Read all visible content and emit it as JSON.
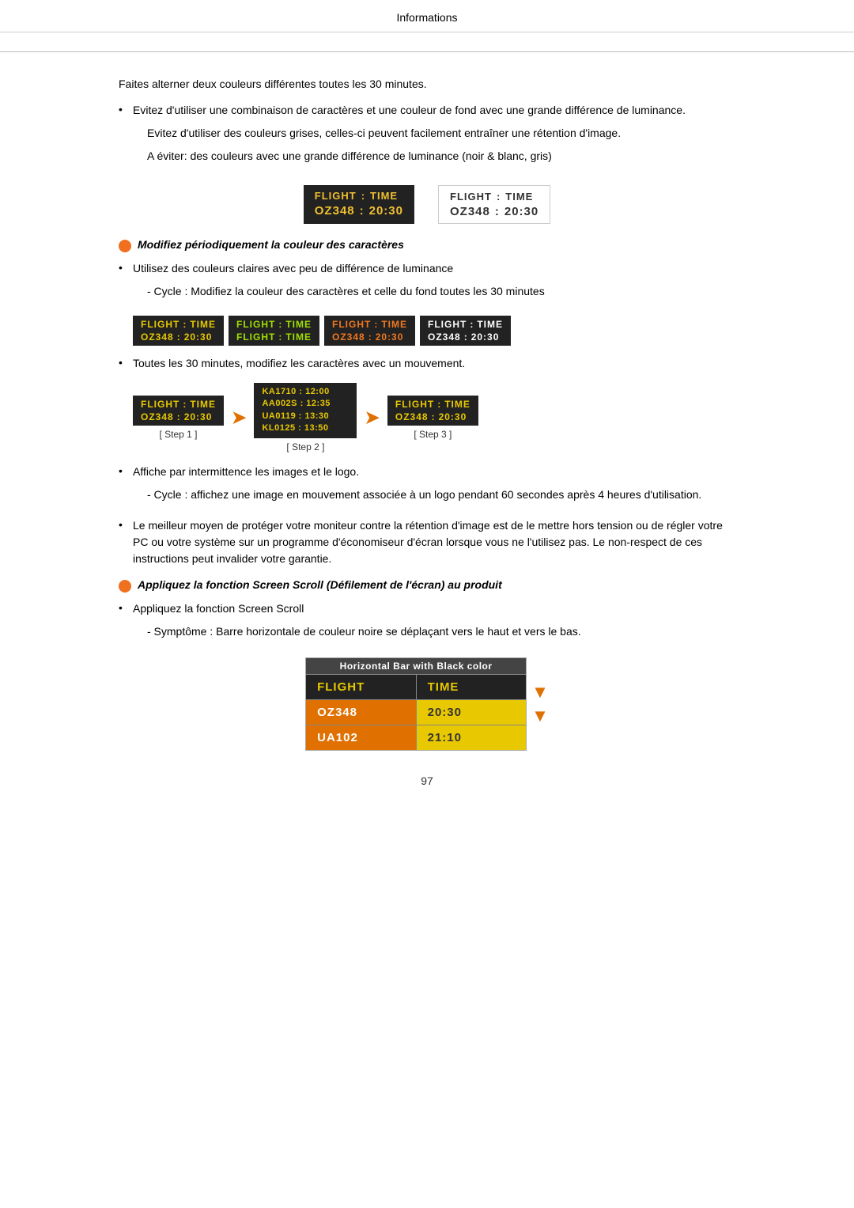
{
  "page": {
    "header": "Informations",
    "page_number": "97"
  },
  "intro": {
    "line1": "Faites alterner deux couleurs différentes toutes les 30 minutes."
  },
  "bullets": {
    "b1_text": "Evitez d'utiliser une combinaison de caractères et une couleur de fond avec une grande différence de luminance.",
    "b1_sub1": "Evitez d'utiliser des couleurs grises, celles-ci peuvent facilement entraîner une rétention d'image.",
    "b1_sub2": "A éviter: des couleurs avec une grande différence de luminance (noir & blanc, gris)"
  },
  "flight_boards": {
    "dark": {
      "title1": "FLIGHT",
      "sep1": ":",
      "title2": "TIME",
      "data1": "OZ348",
      "sep2": ":",
      "data2": "20:30"
    },
    "light": {
      "title1": "FLIGHT",
      "sep1": ":",
      "title2": "TIME",
      "data1": "OZ348",
      "sep2": ":",
      "data2": "20:30"
    }
  },
  "orange_bullet1": {
    "text": "Modifiez périodiquement la couleur des caractères"
  },
  "bullet2_text": "Utilisez des couleurs claires avec peu de différence de luminance",
  "bullet2_sub": "- Cycle : Modifiez la couleur des caractères et celle du fond toutes les 30 minutes",
  "cycle_boards": [
    {
      "t1": "FLIGHT",
      "sep1": ":",
      "t2": "TIME",
      "d1": "OZ348",
      "sep2": ":",
      "d2": "20:30",
      "color": "yellow"
    },
    {
      "t1": "FLIGHT",
      "sep1": ":",
      "t2": "TIME",
      "d1": "FLIGHT",
      "sep2": ":",
      "d2": "TIME",
      "color": "green"
    },
    {
      "t1": "FLIGHT",
      "sep1": ":",
      "t2": "TIME",
      "d1": "OZ348",
      "sep2": ":",
      "d2": "20:30",
      "color": "orange"
    },
    {
      "t1": "FLIGHT",
      "sep1": ":",
      "t2": "TIME",
      "d1": "OZ348",
      "sep2": ":",
      "d2": "20:30",
      "color": "white"
    }
  ],
  "bullet3_text": "Toutes les 30 minutes, modifiez les caractères avec un mouvement.",
  "steps": {
    "step1_label": "[ Step 1 ]",
    "step2_label": "[ Step 2 ]",
    "step3_label": "[ Step 3 ]",
    "step1": {
      "t1": "FLIGHT",
      "sep1": ":",
      "t2": "TIME",
      "d1": "OZ348",
      "sep2": ":",
      "d2": "20:30"
    },
    "step2_lines": [
      "KA1710 : 12:00",
      "AA002S : 12:35",
      "UA0119 : 13:30",
      "KL0125 : 13:50"
    ],
    "step3": {
      "t1": "FLIGHT",
      "sep1": ":",
      "t2": "TIME",
      "d1": "OZ348",
      "sep2": ":",
      "d2": "20:30"
    }
  },
  "bullet4_text": "Affiche par intermittence les images et le logo.",
  "bullet4_sub": "- Cycle : affichez une image en mouvement associée à un logo pendant 60 secondes après 4 heures d'utilisation.",
  "bullet5_text": "Le meilleur moyen de protéger votre moniteur contre la rétention d'image est de le mettre hors tension ou de régler votre PC ou votre système sur un programme d'économiseur d'écran lorsque vous ne l'utilisez pas. Le non-respect de ces instructions peut invalider votre garantie.",
  "orange_bullet2": {
    "text": "Appliquez la fonction Screen Scroll (Défilement de l'écran) au produit"
  },
  "bullet6_text": "Appliquez la fonction Screen Scroll",
  "bullet6_sub": "- Symptôme : Barre horizontale de couleur noire se déplaçant vers le haut et vers le bas.",
  "screen_scroll": {
    "header": "Horizontal Bar with Black color",
    "row1_left": "FLIGHT",
    "row1_right": "TIME",
    "row2_left": "OZ348",
    "row2_right": "20:30",
    "row3_left": "UA102",
    "row3_right": "21:10"
  }
}
